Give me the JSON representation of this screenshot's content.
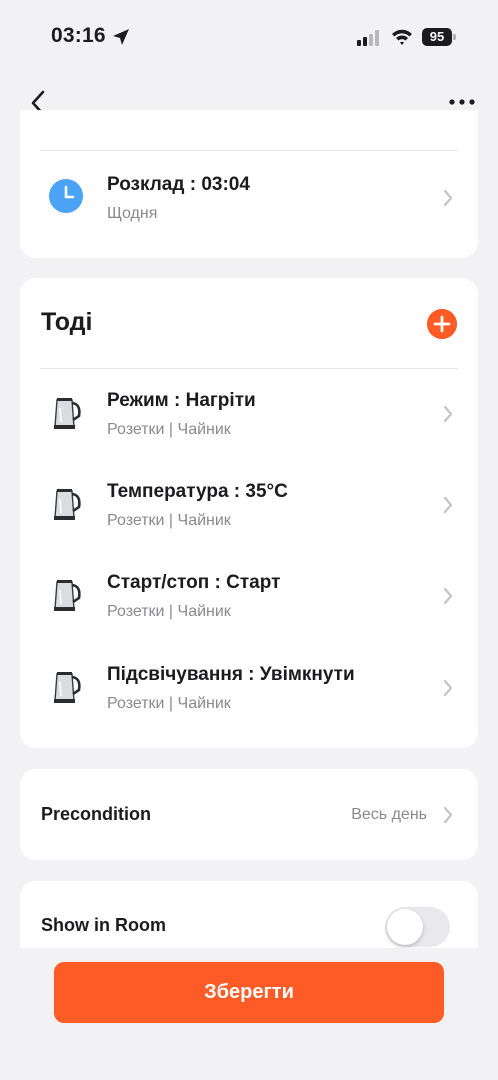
{
  "status_bar": {
    "time": "03:16",
    "battery": "95"
  },
  "if_card": {
    "clipped_label": "…",
    "schedule": {
      "title": "Розклад : 03:04",
      "subtitle": "Щодня",
      "icon": "clock-icon",
      "icon_color": "#4aa3f5"
    }
  },
  "then_card": {
    "title": "Тоді",
    "actions": [
      {
        "title": "Режим : Нагріти",
        "subtitle": "Розетки | Чайник",
        "icon": "kettle-icon"
      },
      {
        "title": "Температура : 35°C",
        "subtitle": "Розетки | Чайник",
        "icon": "kettle-icon"
      },
      {
        "title": "Старт/стоп : Старт",
        "subtitle": "Розетки | Чайник",
        "icon": "kettle-icon"
      },
      {
        "title": "Підсвічування : Увімкнути",
        "subtitle": "Розетки | Чайник",
        "icon": "kettle-icon"
      }
    ]
  },
  "precondition": {
    "label": "Precondition",
    "value": "Весь день"
  },
  "show_in_room": {
    "label": "Show in Room",
    "enabled": false
  },
  "save_button": {
    "label": "Зберегти"
  },
  "colors": {
    "accent": "#ff5b26",
    "background": "#f2f2f5",
    "card": "#ffffff",
    "secondary_text": "#8a8a8e"
  }
}
